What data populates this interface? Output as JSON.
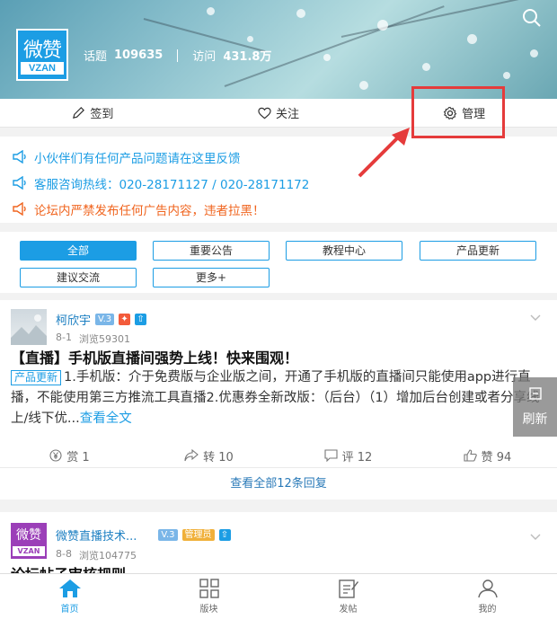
{
  "header": {
    "logo": {
      "cn": "微赞",
      "en": "VZAN"
    },
    "topics_label": "话题",
    "topics_value": "109635",
    "visits_label": "访问",
    "visits_value": "431.8万"
  },
  "actions": {
    "checkin": "签到",
    "follow": "关注",
    "manage": "管理"
  },
  "notices": [
    "小伙伴们有任何产品问题请在这里反馈",
    "客服咨询热线：020-28171127 / 020-28171172",
    "论坛内严禁发布任何广告内容，违者拉黑！"
  ],
  "tags": [
    "全部",
    "重要公告",
    "教程中心",
    "产品更新",
    "建议交流",
    "更多+"
  ],
  "post1": {
    "author": "柯欣宇",
    "level": "V.3",
    "date": "8-1",
    "views": "浏览59301",
    "title": "【直播】手机版直播间强势上线！快来围观！",
    "category": "产品更新",
    "body": "1.手机版：介于免费版与企业版之间，开通了手机版的直播间只能使用app进行直播，不能使用第三方推流工具直播2.优惠券全新改版：（后台）（1）增加后台创建或者分享线上/线下优...",
    "more": "查看全文",
    "reward": "赏 1",
    "repost": "转 10",
    "comment": "评 12",
    "like": "赞 94",
    "replies": "查看全部12条回复"
  },
  "side_float": {
    "refresh": "刷新"
  },
  "post2": {
    "author": "微赞直播技术...",
    "level": "V.3",
    "role": "管理员",
    "date": "8-8",
    "views": "浏览104775",
    "title": "论坛帖子审核规则",
    "avatar": {
      "cn": "微赞",
      "en": "VZAN"
    }
  },
  "nav": [
    "首页",
    "版块",
    "发帖",
    "我的"
  ],
  "colors": {
    "accent": "#1c9de4",
    "warning": "#f0641e",
    "highlight": "#e53b3b"
  }
}
